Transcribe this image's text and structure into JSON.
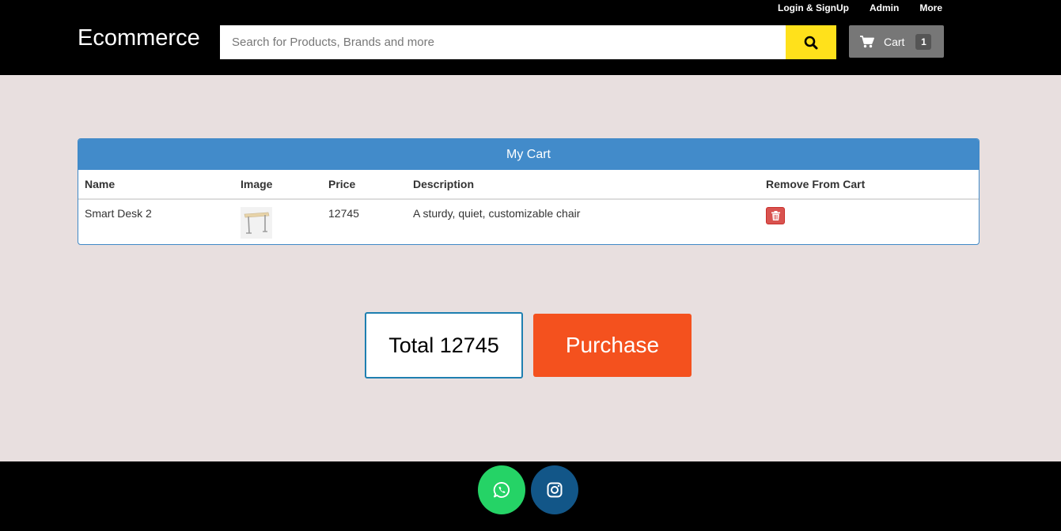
{
  "header": {
    "brand": "Ecommerce",
    "links": [
      "Login & SignUp",
      "Admin",
      "More"
    ],
    "search_placeholder": "Search for Products, Brands and more",
    "search_icon": "search-icon",
    "cart_label": "Cart",
    "cart_count": "1",
    "cart_icon": "shopping-cart-icon"
  },
  "cart": {
    "title": "My Cart",
    "columns": [
      "Name",
      "Image",
      "Price",
      "Description",
      "Remove From Cart"
    ],
    "rows": [
      {
        "name": "Smart Desk 2",
        "image_icon": "desk-thumbnail",
        "price": "12745",
        "description": "A sturdy, quiet, customizable chair",
        "remove_icon": "trash-icon"
      }
    ]
  },
  "summary": {
    "total": "Total 12745",
    "purchase_label": "Purchase"
  },
  "footer": {
    "social": [
      {
        "icon": "whatsapp-icon",
        "color": "#25d366"
      },
      {
        "icon": "instagram-icon",
        "color": "#125688"
      }
    ]
  },
  "colors": {
    "accent_yellow": "#ffe11b",
    "panel_blue": "#428bca",
    "purchase_orange": "#f4511e",
    "delete_red": "#d9534f",
    "page_bg": "#e8dfdf"
  }
}
